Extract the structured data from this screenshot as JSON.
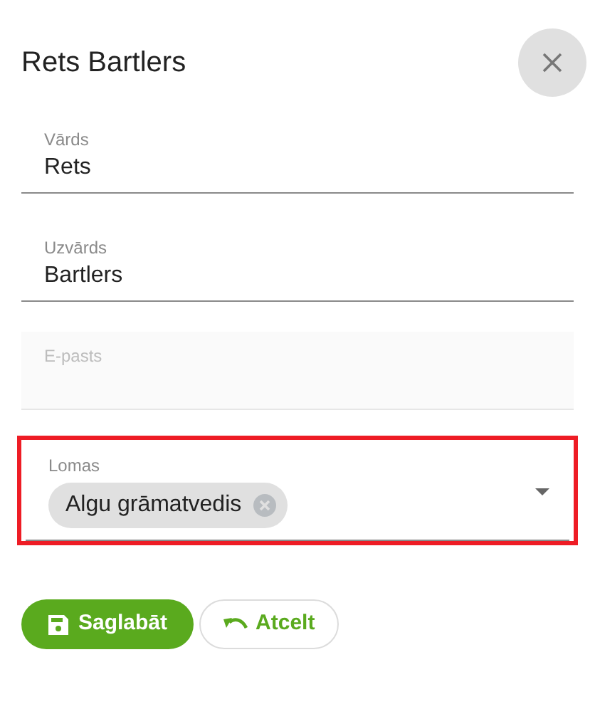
{
  "dialog": {
    "title": "Rets Bartlers"
  },
  "fields": [
    {
      "kind": "text",
      "label": "Vārds",
      "value": "Rets",
      "disabled": false
    },
    {
      "kind": "text",
      "label": "Uzvārds",
      "value": "Bartlers",
      "disabled": false
    },
    {
      "kind": "text",
      "label": "E-pasts",
      "disabled": true
    },
    {
      "kind": "chips",
      "label": "Lomas",
      "chips": [
        "Algu grāmatvedis"
      ],
      "highlighted": true
    }
  ],
  "buttons": [
    {
      "kind": "save",
      "label": "Saglabāt"
    },
    {
      "kind": "cancel",
      "label": "Atcelt"
    }
  ]
}
